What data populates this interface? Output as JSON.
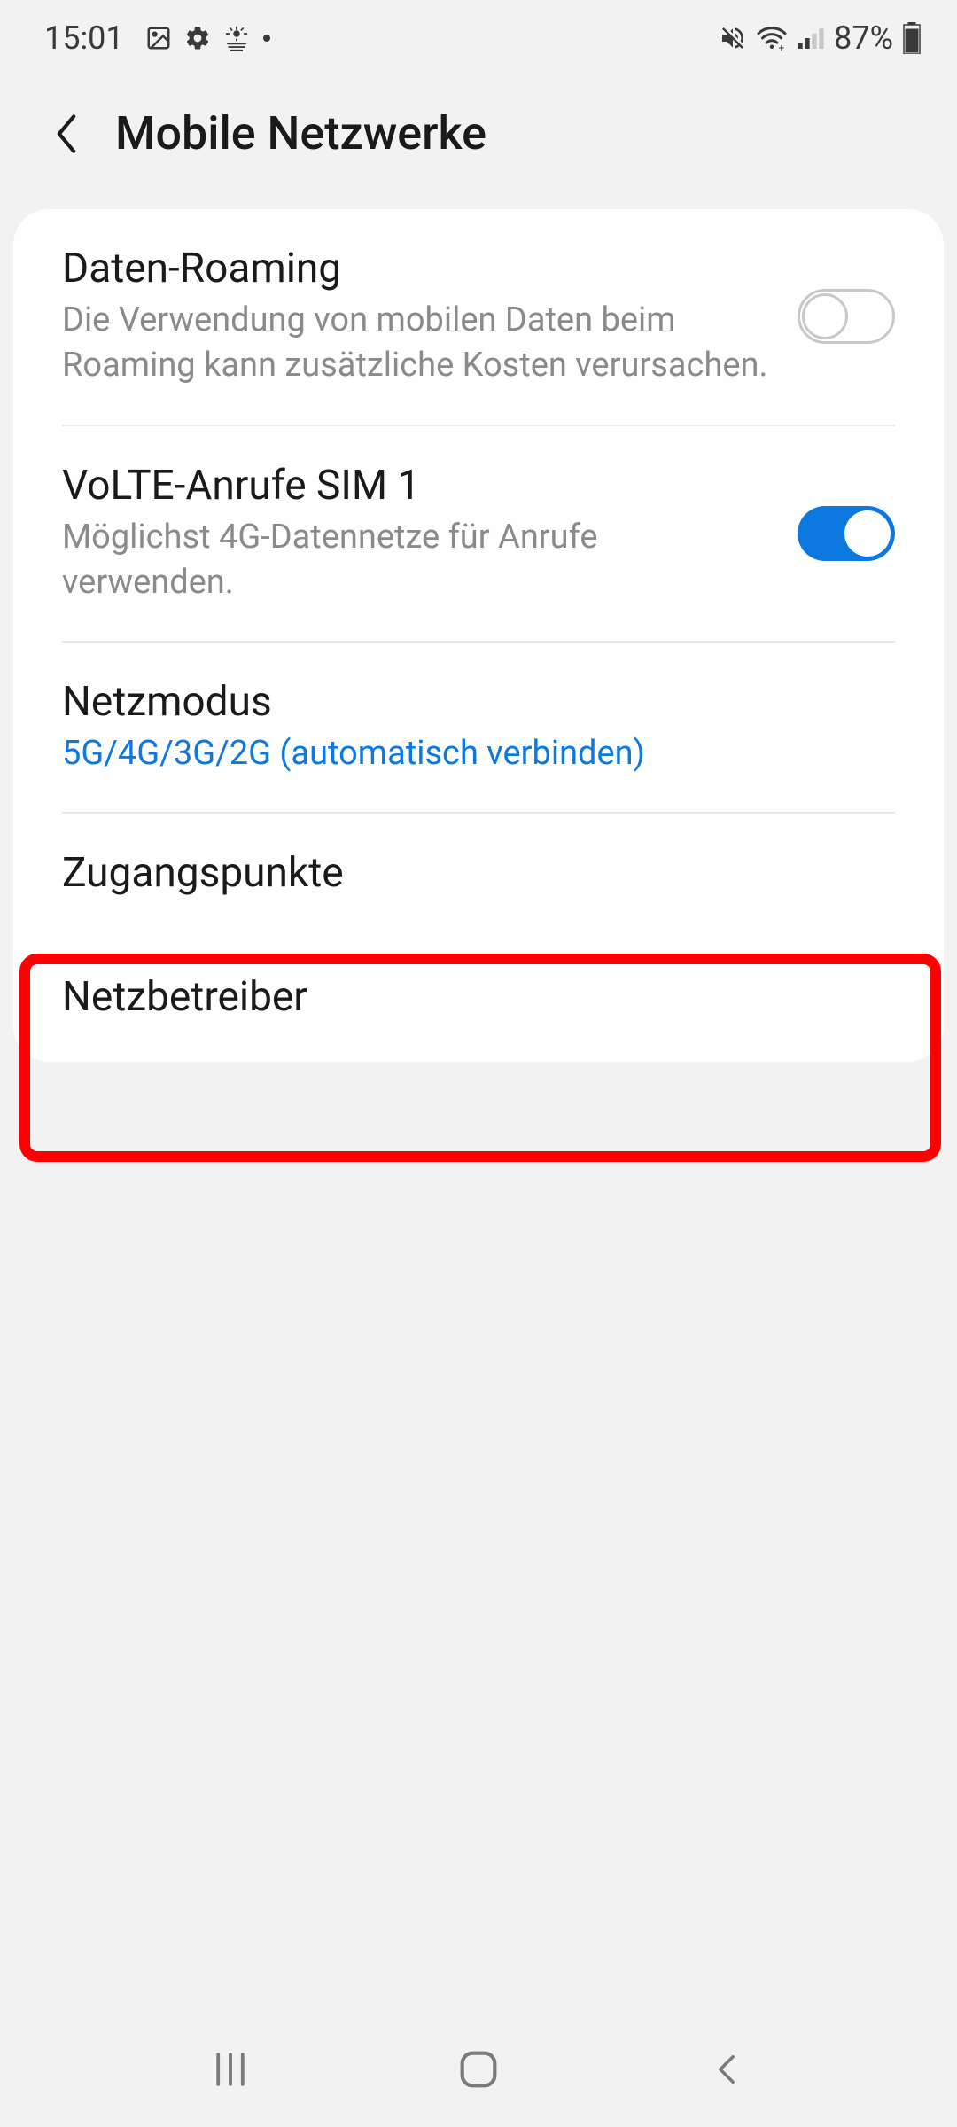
{
  "status": {
    "time": "15:01",
    "battery": "87%"
  },
  "header": {
    "title": "Mobile Netzwerke"
  },
  "settings": [
    {
      "title": "Daten-Roaming",
      "subtitle": "Die Verwendung von mobilen Daten beim Roaming kann zusätzliche Kosten verursachen.",
      "toggle": false
    },
    {
      "title": "VoLTE-Anrufe SIM 1",
      "subtitle": "Möglichst 4G-Datennetze für Anrufe verwenden.",
      "toggle": true
    },
    {
      "title": "Netzmodus",
      "subtitle": "5G/4G/3G/2G (automatisch verbinden)",
      "accent": true
    },
    {
      "title": "Zugangspunkte"
    },
    {
      "title": "Netzbetreiber"
    }
  ]
}
